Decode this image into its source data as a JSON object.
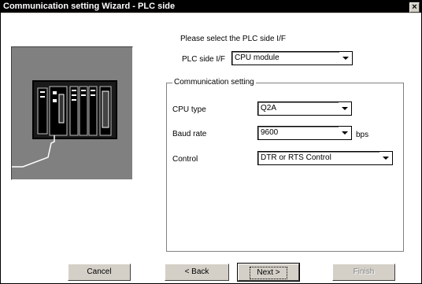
{
  "window": {
    "title": "Communication setting Wizard - PLC side",
    "close_glyph": "×"
  },
  "prompt": "Please select the PLC side I/F",
  "plc_side": {
    "label": "PLC side I/F",
    "value": "CPU module"
  },
  "group": {
    "legend": "Communication setting",
    "cpu_type": {
      "label": "CPU type",
      "value": "Q2A"
    },
    "baud_rate": {
      "label": "Baud rate",
      "value": "9600",
      "unit": "bps"
    },
    "control": {
      "label": "Control",
      "value": "DTR or RTS Control"
    }
  },
  "buttons": {
    "cancel": "Cancel",
    "back": "< Back",
    "next": "Next >",
    "finish": "Finish"
  },
  "icons": {
    "dropdown": "chevron-down-icon",
    "illustration": "plc-unit-icon"
  }
}
